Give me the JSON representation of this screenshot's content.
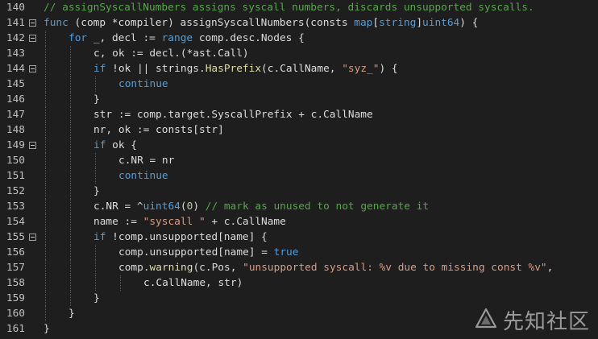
{
  "editor": {
    "lines": [
      {
        "num": "140",
        "fold": false,
        "guides": 0,
        "tokens": [
          [
            "cm",
            "// assignSyscallNumbers assigns syscall numbers, discards unsupported syscalls."
          ]
        ]
      },
      {
        "num": "141",
        "fold": true,
        "guides": 0,
        "tokens": [
          [
            "kw",
            "func"
          ],
          [
            "",
            " (comp *compiler) assignSyscallNumbers(consts "
          ],
          [
            "kw",
            "map"
          ],
          [
            "",
            "["
          ],
          [
            "kw",
            "string"
          ],
          [
            "",
            "]"
          ],
          [
            "kw",
            "uint64"
          ],
          [
            "",
            ") {"
          ]
        ]
      },
      {
        "num": "142",
        "fold": true,
        "guides": 1,
        "tokens": [
          [
            "kw",
            "for"
          ],
          [
            "",
            " _, decl := "
          ],
          [
            "kw",
            "range"
          ],
          [
            "",
            " comp.desc.Nodes {"
          ]
        ]
      },
      {
        "num": "143",
        "fold": false,
        "guides": 2,
        "tokens": [
          [
            "",
            "c, ok := decl.(*ast.Call)"
          ]
        ]
      },
      {
        "num": "144",
        "fold": true,
        "guides": 2,
        "tokens": [
          [
            "kw",
            "if"
          ],
          [
            "",
            " !ok || strings."
          ],
          [
            "fn",
            "HasPrefix"
          ],
          [
            "",
            "(c.CallName, "
          ],
          [
            "st",
            "\"syz_\""
          ],
          [
            "",
            ") {"
          ]
        ]
      },
      {
        "num": "145",
        "fold": false,
        "guides": 3,
        "tokens": [
          [
            "kw",
            "continue"
          ]
        ]
      },
      {
        "num": "146",
        "fold": false,
        "guides": 2,
        "tokens": [
          [
            "",
            "}"
          ]
        ]
      },
      {
        "num": "147",
        "fold": false,
        "guides": 2,
        "tokens": [
          [
            "",
            "str := comp.target.SyscallPrefix + c.CallName"
          ]
        ]
      },
      {
        "num": "148",
        "fold": false,
        "guides": 2,
        "tokens": [
          [
            "",
            "nr, ok := consts[str]"
          ]
        ]
      },
      {
        "num": "149",
        "fold": true,
        "guides": 2,
        "tokens": [
          [
            "kw",
            "if"
          ],
          [
            "",
            " ok {"
          ]
        ]
      },
      {
        "num": "150",
        "fold": false,
        "guides": 3,
        "tokens": [
          [
            "",
            "c.NR = nr"
          ]
        ]
      },
      {
        "num": "151",
        "fold": false,
        "guides": 3,
        "tokens": [
          [
            "kw",
            "continue"
          ]
        ]
      },
      {
        "num": "152",
        "fold": false,
        "guides": 2,
        "tokens": [
          [
            "",
            "}"
          ]
        ]
      },
      {
        "num": "153",
        "fold": false,
        "guides": 2,
        "tokens": [
          [
            "",
            "c.NR = ^"
          ],
          [
            "kw",
            "uint64"
          ],
          [
            "",
            "("
          ],
          [
            "nm",
            "0"
          ],
          [
            "",
            ") "
          ],
          [
            "cm",
            "// mark as unused to not generate it"
          ]
        ]
      },
      {
        "num": "154",
        "fold": false,
        "guides": 2,
        "tokens": [
          [
            "",
            "name := "
          ],
          [
            "st",
            "\"syscall \""
          ],
          [
            "",
            " + c.CallName"
          ]
        ]
      },
      {
        "num": "155",
        "fold": true,
        "guides": 2,
        "tokens": [
          [
            "kw",
            "if"
          ],
          [
            "",
            " !comp.unsupported[name] {"
          ]
        ]
      },
      {
        "num": "156",
        "fold": false,
        "guides": 3,
        "tokens": [
          [
            "",
            "comp.unsupported[name] = "
          ],
          [
            "kw",
            "true"
          ]
        ]
      },
      {
        "num": "157",
        "fold": false,
        "guides": 3,
        "tokens": [
          [
            "",
            "comp."
          ],
          [
            "fn",
            "warning"
          ],
          [
            "",
            "(c.Pos, "
          ],
          [
            "st",
            "\"unsupported syscall: %v due to missing const %v\""
          ],
          [
            "",
            ","
          ]
        ]
      },
      {
        "num": "158",
        "fold": false,
        "guides": 4,
        "tokens": [
          [
            "",
            "c.CallName, str)"
          ]
        ]
      },
      {
        "num": "159",
        "fold": false,
        "guides": 2,
        "tokens": [
          [
            "",
            "}"
          ]
        ]
      },
      {
        "num": "160",
        "fold": false,
        "guides": 1,
        "tokens": [
          [
            "",
            "}"
          ]
        ]
      },
      {
        "num": "161",
        "fold": false,
        "guides": 0,
        "tokens": [
          [
            "",
            "}"
          ]
        ]
      }
    ]
  },
  "watermark": {
    "text": "先知社区",
    "icon": "xianzhi-logo-icon"
  }
}
